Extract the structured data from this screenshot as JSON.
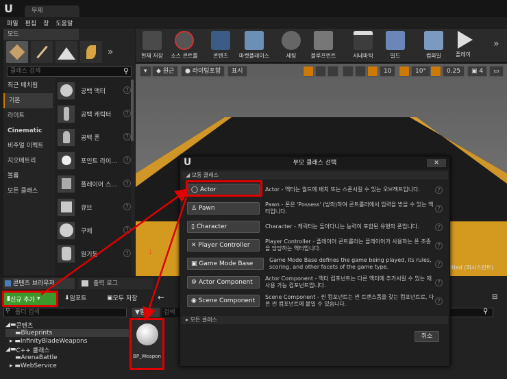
{
  "titlebar": {
    "tab": "무제"
  },
  "menu": [
    "파일",
    "편집",
    "창",
    "도움말"
  ],
  "modes": {
    "tab_label": "모드",
    "search_placeholder": "클래스 검색",
    "categories": [
      "최근 배치됨",
      "기본",
      "라이트",
      "Cinematic",
      "비주얼 이펙트",
      "지오메트리",
      "볼륨",
      "모든 클래스"
    ],
    "items": [
      "공백 액터",
      "공백 캐릭터",
      "공백 폰",
      "포인트 라이...",
      "플레이어 스...",
      "큐브",
      "구체",
      "원기둥"
    ]
  },
  "toolbar": [
    "현재 저장",
    "소스 콘트롤",
    "콘텐츠",
    "마켓플레이스",
    "세팅",
    "블루프린트",
    "시네마틱",
    "빌드",
    "컴파일",
    "플레이"
  ],
  "viewport": {
    "perspective": "원근",
    "lit": "라이팅포함",
    "show": "표시",
    "grid": "10",
    "rot": "10°",
    "scale": "0.25",
    "cam": "4",
    "level_label": "titled (퍼시스턴트)"
  },
  "content_browser": {
    "tab": "콘텐츠 브라우저",
    "tab2": "출력 로그",
    "add_new": "신규 추가",
    "import": "임포트",
    "save_all": "모두 저장",
    "folder_search": "폴더 검색",
    "filter": "필터",
    "search_abbr": "검색",
    "tree": [
      "콘텐츠",
      "Blueprints",
      "InfinityBladeWeapons",
      "C++ 클래스",
      "ArenaBattle",
      "WebService"
    ],
    "asset": "BP_Weapon"
  },
  "dialog": {
    "title": "부모 클래스 선택",
    "section": "보통 클래스",
    "all_classes": "모든 클래스",
    "cancel": "취소",
    "classes": [
      {
        "name": "Actor",
        "desc": "Actor - 액터는 월드에 배치 또는 스폰시킬 수 있는 오브젝트입니다."
      },
      {
        "name": "Pawn",
        "desc": "Pawn - 폰은 'Possess' (빙의)하여 콘트롤러에서 입력을 받을 수 있는 액터입니다."
      },
      {
        "name": "Character",
        "desc": "Character - 캐릭터는 돌아다니는 능력이 포함된 유형의 폰입니다."
      },
      {
        "name": "Player Controller",
        "desc": "Player Controller - 플레이어 콘트롤러는 플레이어가 사용하는 폰 조종을 담당하는 액터입니다."
      },
      {
        "name": "Game Mode Base",
        "desc": "Game Mode Base defines the game being played, its rules, scoring, and other facets of the game type."
      },
      {
        "name": "Actor Component",
        "desc": "Actor Component - 액터 컴포넌트는 다른 액터에 추가시킬 수 있는 재사용 가능 컴포넌트입니다."
      },
      {
        "name": "Scene Component",
        "desc": "Scene Component - 씬 컴포넌트는 씬 트랜스폼을 갖는 컴포넌트로, 다른 씬 컴포넌트에 붙일 수 있습니다."
      }
    ]
  },
  "colors": {
    "accent": "#e00000",
    "add_green": "#3d9a2a",
    "selected_orange": "#cc7a00"
  }
}
